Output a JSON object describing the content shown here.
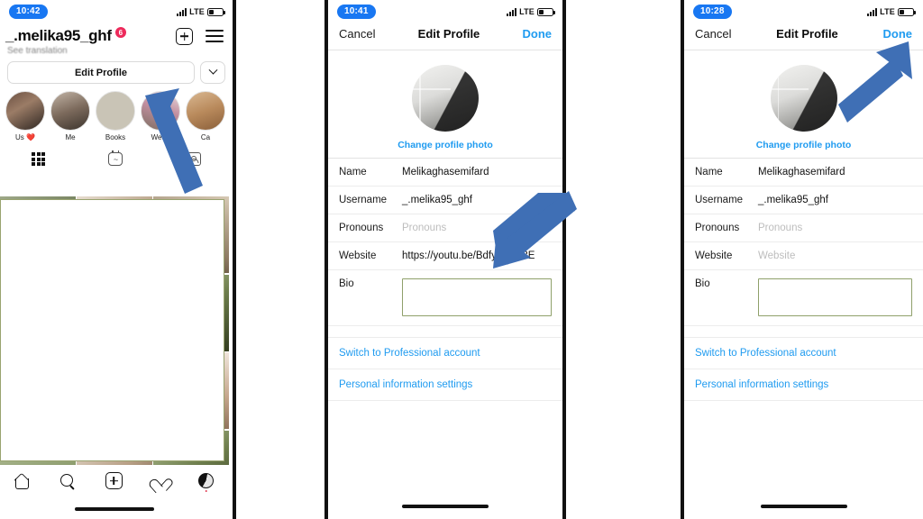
{
  "panels": {
    "profile": {
      "status": {
        "time": "10:42",
        "network": "LTE"
      },
      "username": "_.melika95_ghf",
      "badge": "6",
      "see_translation": "See translation",
      "edit_profile_label": "Edit Profile",
      "highlights": [
        {
          "label": "Us ❤️"
        },
        {
          "label": "Me"
        },
        {
          "label": "Books"
        },
        {
          "label": "Wedd"
        },
        {
          "label": "Ca"
        }
      ],
      "tabs": [
        {
          "icon": "grid-icon"
        },
        {
          "icon": "reels-icon"
        },
        {
          "icon": "tagged-icon"
        }
      ],
      "bottom_nav": [
        {
          "icon": "home-icon"
        },
        {
          "icon": "search-icon"
        },
        {
          "icon": "new-post-icon"
        },
        {
          "icon": "activity-heart-icon"
        },
        {
          "icon": "profile-avatar-icon"
        }
      ]
    },
    "edit_before": {
      "status": {
        "time": "10:41",
        "network": "LTE"
      },
      "nav": {
        "cancel": "Cancel",
        "title": "Edit Profile",
        "done": "Done"
      },
      "change_photo": "Change profile photo",
      "fields": [
        {
          "label": "Name",
          "value": "Melikaghasemifard",
          "placeholder": false
        },
        {
          "label": "Username",
          "value": "_.melika95_ghf",
          "placeholder": false
        },
        {
          "label": "Pronouns",
          "value": "Pronouns",
          "placeholder": true
        },
        {
          "label": "Website",
          "value": "https://youtu.be/BdfyELffD3E",
          "placeholder": false
        }
      ],
      "bio_label": "Bio",
      "links": [
        {
          "label": "Switch to Professional account"
        },
        {
          "label": "Personal information settings"
        }
      ]
    },
    "edit_after": {
      "status": {
        "time": "10:28",
        "network": "LTE"
      },
      "nav": {
        "cancel": "Cancel",
        "title": "Edit Profile",
        "done": "Done"
      },
      "change_photo": "Change profile photo",
      "fields": [
        {
          "label": "Name",
          "value": "Melikaghasemifard",
          "placeholder": false
        },
        {
          "label": "Username",
          "value": "_.melika95_ghf",
          "placeholder": false
        },
        {
          "label": "Pronouns",
          "value": "Pronouns",
          "placeholder": true
        },
        {
          "label": "Website",
          "value": "Website",
          "placeholder": true
        }
      ],
      "bio_label": "Bio",
      "links": [
        {
          "label": "Switch to Professional account"
        },
        {
          "label": "Personal information settings"
        }
      ]
    }
  },
  "annotations": {
    "arrow_color": "#3f6fb5",
    "arrows": [
      {
        "name": "arrow-to-edit-profile",
        "direction": "up-left"
      },
      {
        "name": "arrow-to-website-field",
        "direction": "down-left"
      },
      {
        "name": "arrow-to-done-button",
        "direction": "up-right"
      }
    ]
  }
}
